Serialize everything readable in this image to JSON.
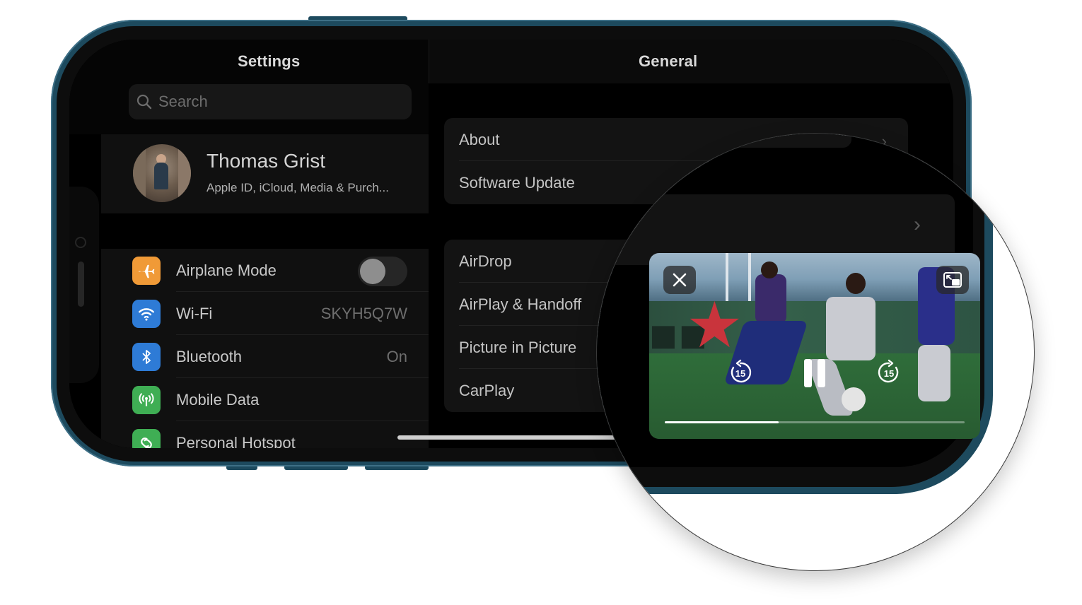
{
  "master": {
    "title": "Settings",
    "search_placeholder": "Search",
    "profile": {
      "name": "Thomas Grist",
      "subtitle": "Apple ID, iCloud, Media & Purch..."
    },
    "rows": [
      {
        "label": "Airplane Mode",
        "value": "",
        "icon": "airplane-icon",
        "color": "#f09a37",
        "toggle": false
      },
      {
        "label": "Wi-Fi",
        "value": "SKYH5Q7W",
        "icon": "wifi-icon",
        "color": "#2e7bd6"
      },
      {
        "label": "Bluetooth",
        "value": "On",
        "icon": "bluetooth-icon",
        "color": "#2e7bd6"
      },
      {
        "label": "Mobile Data",
        "value": "",
        "icon": "antenna-icon",
        "color": "#3fae54"
      },
      {
        "label": "Personal Hotspot",
        "value": "",
        "icon": "hotspot-icon",
        "color": "#3fae54"
      }
    ]
  },
  "detail": {
    "title": "General",
    "group1": [
      "About",
      "Software Update"
    ],
    "group2": [
      "AirDrop",
      "AirPlay & Handoff",
      "Picture in Picture",
      "CarPlay"
    ]
  },
  "pip": {
    "skip_back_seconds": "15",
    "skip_forward_seconds": "15",
    "progress_fraction": 0.38,
    "close_icon": "close-icon",
    "expand_icon": "exit-pip-icon",
    "pause_icon": "pause-icon"
  }
}
